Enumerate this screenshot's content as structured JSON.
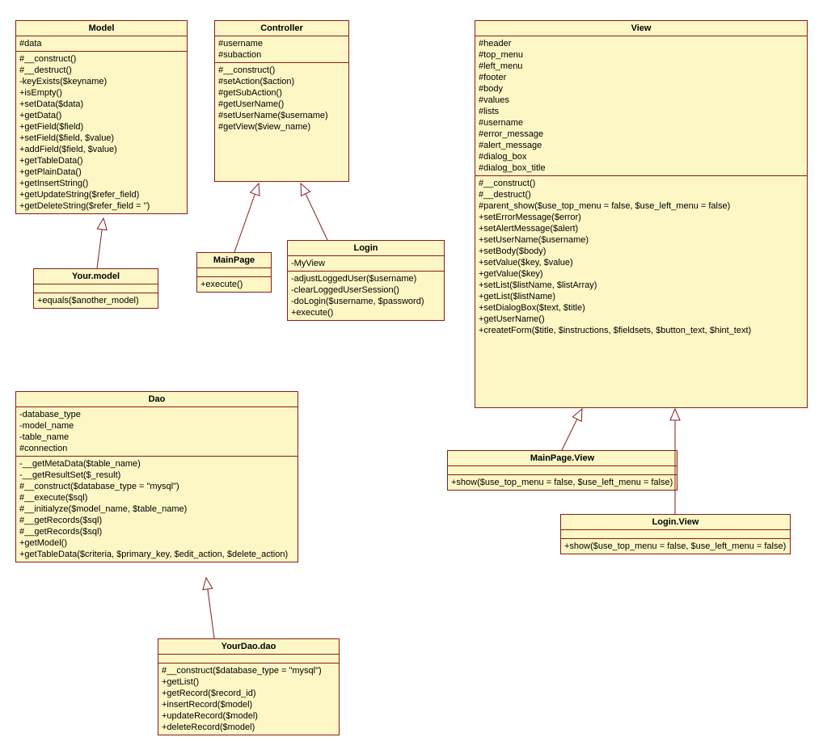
{
  "classes": {
    "model": {
      "title": "Model",
      "attrs": [
        "#data"
      ],
      "ops": [
        "#__construct()",
        "#__destruct()",
        "-keyExists($keyname)",
        "+isEmpty()",
        "+setData($data)",
        "+getData()",
        "+getField($field)",
        "+setField($field, $value)",
        "+addField($field, $value)",
        "+getTableData()",
        "+getPlainData()",
        "+getInsertString()",
        "+getUpdateString($refer_field)",
        "+getDeleteString($refer_field = '')"
      ]
    },
    "yourModel": {
      "title": "Your.model",
      "attrs": [],
      "ops": [
        "+equals($another_model)"
      ]
    },
    "controller": {
      "title": "Controller",
      "attrs": [
        "#username",
        "#subaction"
      ],
      "ops": [
        "#__construct()",
        "#setAction($action)",
        "#getSubAction()",
        "#getUserName()",
        "#setUserName($username)",
        "#getView($view_name)"
      ]
    },
    "mainPage": {
      "title": "MainPage",
      "attrs": [],
      "ops": [
        "+execute()"
      ]
    },
    "login": {
      "title": "Login",
      "attrs": [
        "-MyView"
      ],
      "ops": [
        "-adjustLoggedUser($username)",
        "-clearLoggedUserSession()",
        "-doLogin($username, $password)",
        "+execute()"
      ]
    },
    "view": {
      "title": "View",
      "attrs": [
        "#header",
        "#top_menu",
        "#left_menu",
        "#footer",
        "#body",
        "#values",
        "#lists",
        "#username",
        "#error_message",
        "#alert_message",
        "#dialog_box",
        "#dialog_box_title"
      ],
      "ops": [
        "#__construct()",
        "#__destruct()",
        "#parent_show($use_top_menu = false, $use_left_menu = false)",
        "+setErrorMessage($error)",
        "+setAlertMessage($alert)",
        "+setUserName($username)",
        "+setBody($body)",
        "+setValue($key, $value)",
        "+getValue($key)",
        "+setList($listName, $listArray)",
        "+getList($listName)",
        "+setDialogBox($text, $title)",
        "+getUserName()",
        "+createtForm($title, $instructions, $fieldsets, $button_text, $hint_text)"
      ]
    },
    "mainPageView": {
      "title": "MainPage.View",
      "attrs": [],
      "ops": [
        "+show($use_top_menu = false, $use_left_menu = false)"
      ]
    },
    "loginView": {
      "title": "Login.View",
      "attrs": [],
      "ops": [
        "+show($use_top_menu = false, $use_left_menu = false)"
      ]
    },
    "dao": {
      "title": "Dao",
      "attrs": [
        "-database_type",
        "-model_name",
        "-table_name",
        "#connection"
      ],
      "ops": [
        "-__getMetaData($table_name)",
        "-__getResultSet($_result)",
        "#__construct($database_type = \"mysql\")",
        "#__execute($sql)",
        "#__initialyze($model_name, $table_name)",
        "#__getRecords($sql)",
        "#__getRecords($sql)",
        "+getModel()",
        "+getTableData($criteria, $primary_key, $edit_action, $delete_action)"
      ]
    },
    "yourDao": {
      "title": "YourDao.dao",
      "attrs": [],
      "ops": [
        "#__construct($database_type = \"mysql\")",
        "+getList()",
        "+getRecord($record_id)",
        "+insertRecord($model)",
        "+updateRecord($model)",
        "+deleteRecord($model)"
      ]
    }
  }
}
